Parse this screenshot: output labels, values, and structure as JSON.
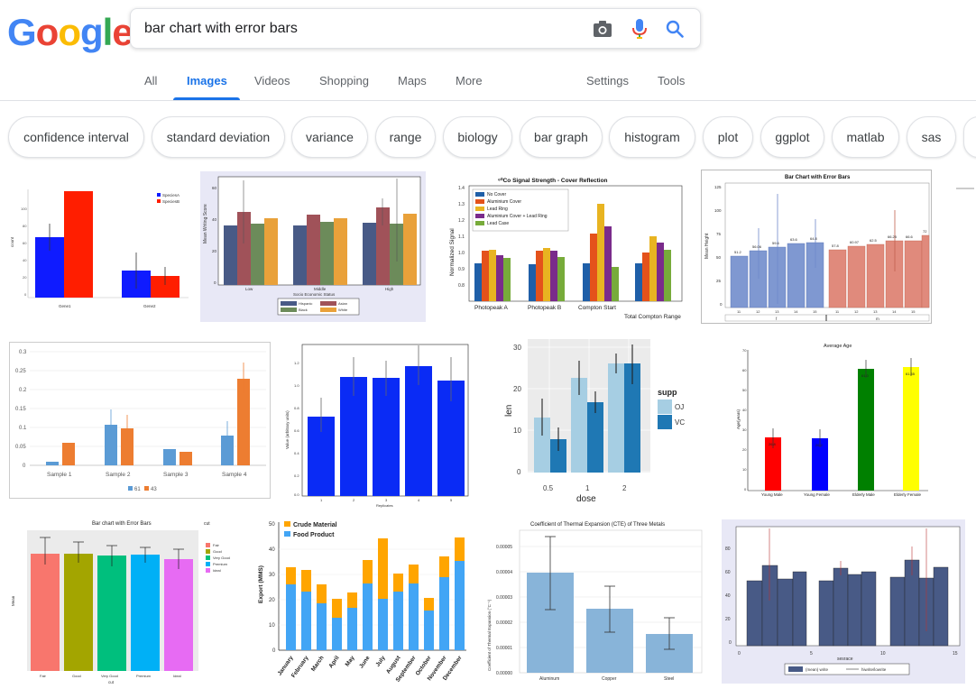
{
  "logo": [
    "G",
    "o",
    "o",
    "g",
    "l",
    "e"
  ],
  "search": {
    "query": "bar chart with error bars"
  },
  "tabs": [
    {
      "label": "All"
    },
    {
      "label": "Images"
    },
    {
      "label": "Videos"
    },
    {
      "label": "Shopping"
    },
    {
      "label": "Maps"
    },
    {
      "label": "More"
    },
    {
      "label": "Settings"
    },
    {
      "label": "Tools"
    }
  ],
  "chips": [
    "confidence interval",
    "standard deviation",
    "variance",
    "range",
    "biology",
    "bar graph",
    "histogram",
    "plot",
    "ggplot",
    "matlab",
    "sas"
  ],
  "icons": [
    "camera-icon",
    "microphone-icon",
    "search-icon"
  ],
  "colors": {
    "accent": "#1a73e8",
    "muted": "#5f6368"
  },
  "thumbs": {
    "t1": {
      "legend": [
        "SpeciesA",
        "SpeciesB"
      ],
      "xticks": [
        "Gene1",
        "Gene2"
      ],
      "ylabel": "count",
      "yticks": [
        "100",
        "80",
        "60",
        "40",
        "20",
        "0"
      ]
    },
    "t2": {
      "ylabel": "Mean Writing Score",
      "xlabel": "Socio Economic Status",
      "xticks": [
        "Low",
        "Middle",
        "High"
      ],
      "yticks": [
        "60",
        "40",
        "20",
        "0"
      ],
      "legend": [
        "Hispanic",
        "Asian",
        "Black",
        "White"
      ]
    },
    "t3": {
      "title": "⁶⁰Co Signal Strength - Cover Reflection",
      "ylabel": "Normalized Signal",
      "xticks": [
        "Photopeak A",
        "Photopeak B",
        "Compton Start",
        "Total Compton Range"
      ],
      "yticks": [
        "1.4",
        "1.3",
        "1.2",
        "1.1",
        "1.0",
        "0.9",
        "0.8"
      ],
      "legend": [
        "No Cover",
        "Aluminium Cover",
        "Lead Ring",
        "Aluminium Cover + Lead Ring",
        "Lead Case"
      ]
    },
    "t4": {
      "title": "Bar Chart with Error Bars",
      "ylabel": "Mean Height",
      "yticks": [
        "125",
        "100",
        "75",
        "50",
        "25",
        "0"
      ],
      "xticks": [
        "11",
        "12",
        "13",
        "14",
        "15",
        "11",
        "12",
        "13",
        "14",
        "15"
      ],
      "labels": [
        "51.2",
        "56.06",
        "59.6",
        "63.6",
        "64.8",
        "57.8",
        "60.97",
        "62.5",
        "66.25",
        "66.6",
        "72"
      ],
      "groups": [
        "f",
        "m"
      ]
    },
    "t5": {
      "yticks": [
        "0.3",
        "0.25",
        "0.2",
        "0.15",
        "0.1",
        "0.05",
        "0"
      ],
      "xticks": [
        "Sample 1",
        "Sample 2",
        "Sample 3",
        "Sample 4"
      ],
      "legend": [
        "61",
        "43"
      ]
    },
    "t6": {
      "ylabel": "Value (arbitrary units)",
      "xlabel": "Replicates",
      "yticks": [
        "1.2",
        "1.0",
        "0.8",
        "0.6",
        "0.4",
        "0.2",
        "0.0"
      ],
      "xticks": [
        "1",
        "2",
        "3",
        "4",
        "5"
      ]
    },
    "t7": {
      "ylabel": "len",
      "xlabel": "dose",
      "yticks": [
        "30",
        "20",
        "10",
        "0"
      ],
      "xticks": [
        "0.5",
        "1",
        "2"
      ],
      "legend_title": "supp",
      "legend": [
        "OJ",
        "VC"
      ]
    },
    "t8": {
      "title": "Average Age",
      "ylabel": "Age(years)",
      "yticks": [
        "70",
        "60",
        "50",
        "40",
        "30",
        "20",
        "10",
        "0"
      ],
      "xticks": [
        "Young Male",
        "Young Female",
        "Elderly Male",
        "Elderly Female"
      ],
      "labels": [
        "26.8",
        "26.2",
        "61.0",
        "61.55"
      ]
    },
    "t9": {
      "title": "Bar chart with Error Bars",
      "legend_title": "cut",
      "ylabel": "Mean",
      "xlabel": "cut",
      "xticks": [
        "Fair",
        "Good",
        "Very Good",
        "Premium",
        "Ideal"
      ],
      "legend": [
        "Fair",
        "Good",
        "Very Good",
        "Premium",
        "Ideal"
      ]
    },
    "t10": {
      "ylabel": "Export (MMS)",
      "yticks": [
        "50",
        "40",
        "30",
        "20",
        "10",
        "0"
      ],
      "xticks": [
        "January",
        "February",
        "March",
        "April",
        "May",
        "June",
        "July",
        "August",
        "September",
        "October",
        "November",
        "December"
      ],
      "legend": [
        "Crude Material",
        "Food Product"
      ]
    },
    "t11": {
      "title": "Coefficient of Thermal Expansion (CTE) of Three Metals",
      "ylabel": "Coefficient of Thermal Expansion (°C⁻¹)",
      "yticks": [
        "0.00005",
        "0.00004",
        "0.00003",
        "0.00002",
        "0.00001",
        "0.00000"
      ],
      "xticks": [
        "Aluminum",
        "Copper",
        "Steel"
      ]
    },
    "t12": {
      "yticks": [
        "80",
        "60",
        "40",
        "20",
        "0"
      ],
      "xticks": [
        "0",
        "5",
        "10",
        "15"
      ],
      "xlabel": "sesrace",
      "legend": [
        "(mean) write",
        "hiwrite/lowrite"
      ]
    }
  }
}
